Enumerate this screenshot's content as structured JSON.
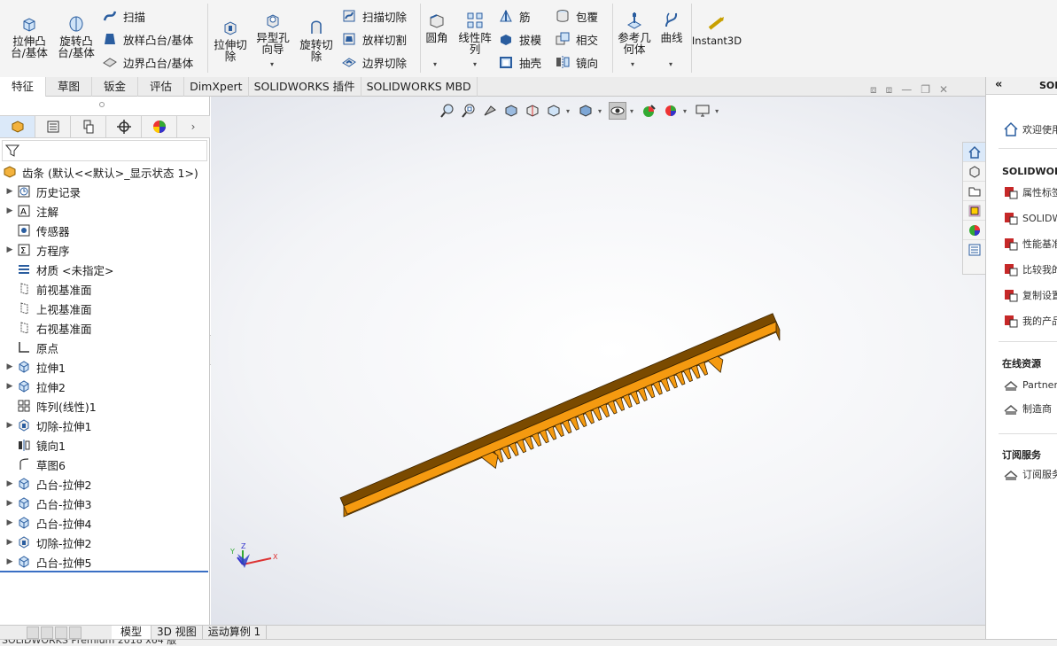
{
  "ribbon": {
    "extrude_boss": "拉伸凸\n台/基体",
    "revolve_boss": "旋转凸\n台/基体",
    "sweep": "扫描",
    "loft_boss": "放样凸台/基体",
    "boundary_boss": "边界凸台/基体",
    "extrude_cut": "拉伸切\n除",
    "hole_wizard": "异型孔\n向导",
    "revolve_cut": "旋转切\n除",
    "swept_cut": "扫描切除",
    "lofted_cut": "放样切割",
    "boundary_cut": "边界切除",
    "fillet": "圆角",
    "linear_pattern": "线性阵\n列",
    "rib": "筋",
    "draft": "拔模",
    "shell": "抽壳",
    "wrap": "包覆",
    "intersect": "相交",
    "mirror": "镜向",
    "ref_geometry": "参考几\n何体",
    "curves": "曲线",
    "instant3d": "Instant3D"
  },
  "tabs": [
    "特征",
    "草图",
    "钣金",
    "评估",
    "DimXpert",
    "SOLIDWORKS 插件",
    "SOLIDWORKS MBD"
  ],
  "tree": {
    "root": "齿条  (默认<<默认>_显示状态 1>)",
    "items": [
      {
        "label": "历史记录",
        "expand": true,
        "icon": "history-icon"
      },
      {
        "label": "注解",
        "expand": true,
        "icon": "annotation-icon"
      },
      {
        "label": "传感器",
        "expand": false,
        "icon": "sensor-icon"
      },
      {
        "label": "方程序",
        "expand": true,
        "icon": "equation-icon"
      },
      {
        "label": "材质 <未指定>",
        "expand": false,
        "icon": "material-icon"
      },
      {
        "label": "前视基准面",
        "expand": false,
        "icon": "plane-icon"
      },
      {
        "label": "上视基准面",
        "expand": false,
        "icon": "plane-icon"
      },
      {
        "label": "右视基准面",
        "expand": false,
        "icon": "plane-icon"
      },
      {
        "label": "原点",
        "expand": false,
        "icon": "origin-icon"
      },
      {
        "label": "拉伸1",
        "expand": true,
        "icon": "extrude-icon"
      },
      {
        "label": "拉伸2",
        "expand": true,
        "icon": "extrude-icon"
      },
      {
        "label": "阵列(线性)1",
        "expand": false,
        "icon": "pattern-icon"
      },
      {
        "label": "切除-拉伸1",
        "expand": true,
        "icon": "cut-icon"
      },
      {
        "label": "镜向1",
        "expand": false,
        "icon": "mirror-icon"
      },
      {
        "label": "草图6",
        "expand": false,
        "icon": "sketch-icon"
      },
      {
        "label": "凸台-拉伸2",
        "expand": true,
        "icon": "extrude-icon"
      },
      {
        "label": "凸台-拉伸3",
        "expand": true,
        "icon": "extrude-icon"
      },
      {
        "label": "凸台-拉伸4",
        "expand": true,
        "icon": "extrude-icon"
      },
      {
        "label": "切除-拉伸2",
        "expand": true,
        "icon": "cut-icon"
      },
      {
        "label": "凸台-拉伸5",
        "expand": true,
        "icon": "extrude-icon"
      }
    ]
  },
  "bottom_tabs": [
    "模型",
    "3D 视图",
    "运动算例 1"
  ],
  "statusbar": "SOLIDWORKS Premium 2018 x64 版",
  "taskpane": {
    "header": "SOI",
    "welcome": "欢迎使用",
    "section1": "SOLIDWORK",
    "items1": [
      "属性标签",
      "SOLIDW",
      "性能基准",
      "比较我的",
      "复制设置",
      "我的产品"
    ],
    "section2": "在线资源",
    "items2": [
      "Partner",
      "制造商"
    ],
    "section3": "订阅服务",
    "items3": [
      "订阅服务"
    ]
  },
  "colors": {
    "part": "#f59a10",
    "accent": "#3a6fc4"
  }
}
